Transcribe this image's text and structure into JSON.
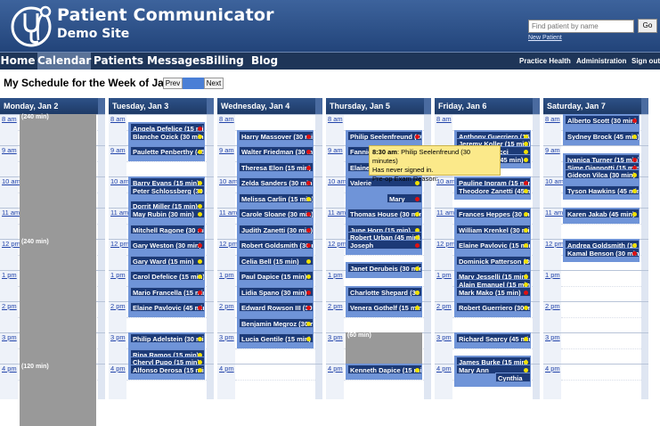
{
  "header": {
    "app_title": "Patient Communicator",
    "site_title": "Demo Site",
    "search_placeholder": "Find patient by name",
    "go_label": "Go",
    "new_patient": "New Patient"
  },
  "nav": {
    "items": [
      {
        "label": "Home"
      },
      {
        "label": "Calendar",
        "active": true
      },
      {
        "label": "Patients"
      },
      {
        "label": "Messages"
      },
      {
        "label": "Billing"
      },
      {
        "label": "Blog"
      }
    ],
    "right": [
      {
        "label": "Practice Health"
      },
      {
        "label": "Administration"
      },
      {
        "label": "Sign out"
      }
    ]
  },
  "schedule": {
    "title": "My Schedule for the Week of Jan 2",
    "prev": "Prev",
    "today": "",
    "next": "Next",
    "time_labels": [
      "8 am",
      "9 am",
      "10 am",
      "11 am",
      "12 pm",
      "1 pm",
      "2 pm",
      "3 pm",
      "4 pm"
    ]
  },
  "days": [
    {
      "header": "Monday, Jan 2",
      "blocks": [
        {
          "label": "(240 min)",
          "start": 8.0,
          "end": 12.0
        },
        {
          "label": "(240 min)",
          "start": 12.0,
          "end": 16.0
        },
        {
          "label": "(120 min)",
          "start": 16.0,
          "end": 18.0
        }
      ],
      "appts": []
    },
    {
      "header": "Tuesday, Jan 3",
      "blocks": [],
      "appts": [
        {
          "label": "Angela Defelice (15 min)",
          "start": 8.25,
          "status": "red"
        },
        {
          "label": "Blanche Ozick (30 min)",
          "start": 8.5,
          "status": "yellow"
        },
        {
          "label": "Paulette Penberthy (45 min)",
          "start": 9.0,
          "status": "yellow"
        },
        {
          "label": "Barry Evans (15 min)",
          "start": 10.0,
          "status": "yellow"
        },
        {
          "label": "Peter Schlossberg (30 min)",
          "start": 10.25,
          "status": "yellow"
        },
        {
          "label": "Dorrit Miller (15 min)",
          "start": 10.75,
          "status": "yellow"
        },
        {
          "label": "May Rubin (30 min)",
          "start": 11.0,
          "status": "yellow"
        },
        {
          "label": "Mitchell Ragone (30 min)",
          "start": 11.5,
          "status": "red"
        },
        {
          "label": "Gary Weston (30 min)",
          "start": 12.0,
          "status": "red"
        },
        {
          "label": "Gary Ward (15 min)",
          "start": 12.5,
          "status": "yellow"
        },
        {
          "label": "Carol Defelice (15 min)",
          "start": 13.0,
          "status": "yellow"
        },
        {
          "label": "Mario Francella (15 min)",
          "start": 13.5,
          "status": "red"
        },
        {
          "label": "Elaine Pavlovic (45 min)",
          "start": 14.0,
          "status": "red"
        },
        {
          "label": "Philip Adelstein (30 min)",
          "start": 15.0,
          "status": "yellow"
        },
        {
          "label": "Rina Ramos (15 min)",
          "start": 15.5,
          "status": "yellow"
        },
        {
          "label": "Cheryl Pupo (15 min)",
          "start": 15.75,
          "status": "yellow"
        },
        {
          "label": "Alfonso Derosa (15 min)",
          "start": 16.0,
          "status": "yellow"
        }
      ]
    },
    {
      "header": "Wednesday, Jan 4",
      "blocks": [],
      "appts": [
        {
          "label": "Harry Massover (30 min)",
          "start": 8.5,
          "status": "red"
        },
        {
          "label": "Walter Friedman (30 min)",
          "start": 9.0,
          "status": "red"
        },
        {
          "label": "Theresa Elon (15 min)",
          "start": 9.5,
          "status": "red"
        },
        {
          "label": "Zelda Sanders (30 min)",
          "start": 10.0,
          "status": "red"
        },
        {
          "label": "Melissa Carlin (15 min)",
          "start": 10.5,
          "status": "yellow"
        },
        {
          "label": "Carole Sloane (30 min)",
          "start": 11.0,
          "status": "red"
        },
        {
          "label": "Judith Zanetti (30 min)",
          "start": 11.5,
          "status": "red"
        },
        {
          "label": "Robert Goldsmith (30 min)",
          "start": 12.0,
          "status": "red"
        },
        {
          "label": "Celia Bell (15 min)",
          "start": 12.5,
          "status": "yellow"
        },
        {
          "label": "Paul Dapice (15 min)",
          "start": 13.0,
          "status": "yellow"
        },
        {
          "label": "Lidia Spano (30 min)",
          "start": 13.5,
          "status": "red"
        },
        {
          "label": "Edward Rowson III (30 min)",
          "start": 14.0,
          "status": "red"
        },
        {
          "label": "Benjamin Megroz (30 min)",
          "start": 14.5,
          "status": "yellow"
        },
        {
          "label": "Lucia Gentile (15 min)",
          "start": 15.0,
          "status": "yellow"
        }
      ]
    },
    {
      "header": "Thursday, Jan 5",
      "blocks": [
        {
          "label": "(60 min)",
          "start": 15.0,
          "end": 16.0
        }
      ],
      "appts": [
        {
          "label": "Philip Seelenfreund (30 min)",
          "start": 8.5,
          "status": "red"
        },
        {
          "label": "Fannie",
          "start": 9.0,
          "status": "red"
        },
        {
          "label": "Elaine",
          "start": 9.5,
          "status": "yellow"
        },
        {
          "label": "Valerie",
          "start": 10.0,
          "status": "yellow"
        },
        {
          "label": "Mary",
          "start": 10.5,
          "status": "red",
          "indent": true
        },
        {
          "label": "Thomas House (30 min)",
          "start": 11.0,
          "status": "yellow"
        },
        {
          "label": "June Horn (15 min)",
          "start": 11.5,
          "status": "yellow"
        },
        {
          "label": "Robert Urban (45 min)",
          "start": 11.75,
          "status": "yellow"
        },
        {
          "label": "Joseph",
          "start": 12.0,
          "status": "red"
        },
        {
          "label": "Janet Derubeis (30 min)",
          "start": 12.75,
          "status": "yellow"
        },
        {
          "label": "Charlotte Shepard (30 min)",
          "start": 13.5,
          "status": "yellow"
        },
        {
          "label": "Venera Gothelf (15 min)",
          "start": 14.0,
          "status": "yellow"
        },
        {
          "label": "Kenneth Dapice (15 min)",
          "start": 16.0,
          "status": "yellow"
        }
      ],
      "tooltip": {
        "time": "8:30 am",
        "text": ": Philip Seelenfreund (30 minutes)",
        "line2": "Has never signed in.",
        "line3": "Pre-op Exam Reason:"
      }
    },
    {
      "header": "Friday, Jan 6",
      "blocks": [],
      "appts": [
        {
          "label": "Anthony Guerriero (15 min)",
          "start": 8.5,
          "status": "yellow"
        },
        {
          "label": "Jeremy Koller (15 min)",
          "start": 8.75,
          "status": "yellow"
        },
        {
          "label": "Sherri Carducci",
          "start": 9.0,
          "status": "yellow"
        },
        {
          "label": "Heidi Kruse (45 min)",
          "start": 9.25,
          "status": "yellow"
        },
        {
          "label": "Pauline Ingram (15 min)",
          "start": 10.0,
          "status": "red"
        },
        {
          "label": "Theodore Zanetti (45 min)",
          "start": 10.25,
          "status": "yellow"
        },
        {
          "label": "Frances Heppes (30 min)",
          "start": 11.0,
          "status": "yellow"
        },
        {
          "label": "William Krenkel (30 min)",
          "start": 11.5,
          "status": "yellow"
        },
        {
          "label": "Elaine Pavlovic (15 min)",
          "start": 12.0,
          "status": "yellow"
        },
        {
          "label": "Dominick Patterson (30 min)",
          "start": 12.5,
          "status": "yellow"
        },
        {
          "label": "Mary Jesselli (15 min)",
          "start": 13.0,
          "status": "yellow"
        },
        {
          "label": "Alain Emanuel (15 min)",
          "start": 13.25,
          "status": "yellow"
        },
        {
          "label": "Mark Mako (15 min)",
          "start": 13.5,
          "status": "red"
        },
        {
          "label": "Robert Guerriero (30 min)",
          "start": 14.0,
          "status": "yellow"
        },
        {
          "label": "Richard Searcy (45 min)",
          "start": 15.0,
          "status": "yellow"
        },
        {
          "label": "James Burke (15 min)",
          "start": 15.75,
          "status": "yellow"
        },
        {
          "label": "Mary Ann",
          "start": 16.0,
          "status": "yellow"
        },
        {
          "label": "Cynthia",
          "start": 16.25,
          "status": "",
          "indent": true
        }
      ]
    },
    {
      "header": "Saturday, Jan 7",
      "blocks": [],
      "appts": [
        {
          "label": "Alberto Scott (30 min)",
          "start": 8.0,
          "status": "red"
        },
        {
          "label": "Sydney Brock (45 min)",
          "start": 8.5,
          "status": "yellow"
        },
        {
          "label": "Ivanica Turner (15 min)",
          "start": 9.25,
          "status": "red"
        },
        {
          "label": "Sime Giannotti (15 min)",
          "start": 9.5,
          "status": "red"
        },
        {
          "label": "Gideon Vilca (30 min)",
          "start": 9.75,
          "status": "yellow"
        },
        {
          "label": "Tyson Hawkins (45 min)",
          "start": 10.25,
          "status": "yellow"
        },
        {
          "label": "Karen Jakab (45 min)",
          "start": 11.0,
          "status": "yellow"
        },
        {
          "label": "Andrea Goldsmith (15 min)",
          "start": 12.0,
          "status": "yellow"
        },
        {
          "label": "Kamal Benson (30 min)",
          "start": 12.25,
          "status": "red"
        }
      ]
    }
  ],
  "colors": {
    "header": "#2a4a80",
    "appt": "#1c3a77",
    "lane": "#6f94d8",
    "pending": "#f0e000",
    "confirmed": "#e01010",
    "tooltip": "#fbe98a"
  }
}
